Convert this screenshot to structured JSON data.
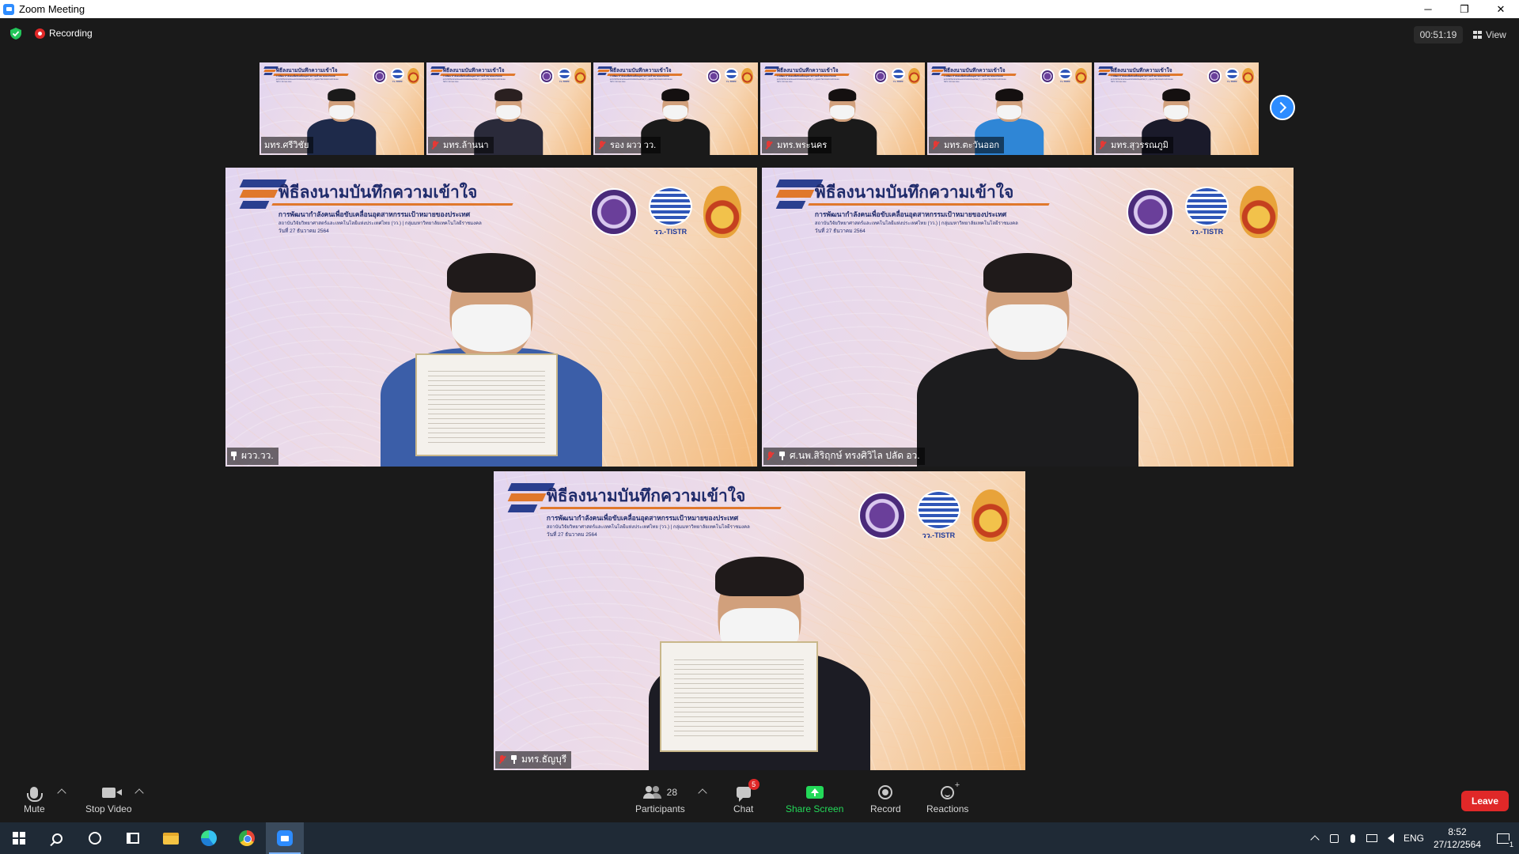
{
  "window": {
    "title": "Zoom Meeting",
    "controls": [
      "─",
      "❐",
      "✕"
    ]
  },
  "status": {
    "recording_label": "Recording",
    "elapsed": "00:51:19",
    "view_label": "View"
  },
  "slide": {
    "heading": "พิธีลงนามบันทึกความเข้าใจ",
    "subtitle": "การพัฒนากำลังคนเพื่อขับเคลื่อนอุตสาหกรรมเป้าหมายของประเทศ",
    "org_line": "สถาบันวิจัยวิทยาศาสตร์และเทคโนโลยีแห่งประเทศไทย (วว.) | กลุ่มมหาวิทยาลัยเทคโนโลยีราชมงคล",
    "date_line": "วันที่ 27 ธันวาคม 2564",
    "tistra_label": "วว.-TISTR"
  },
  "thumbnails": [
    {
      "name": "มทร.ศรีวิชัย",
      "muted": false,
      "suit": "#1e2a4a",
      "hair": "#1a1a1a"
    },
    {
      "name": "มทร.ล้านนา",
      "muted": true,
      "suit": "#2a2a3a",
      "hair": "#2a2020"
    },
    {
      "name": "รอง ผวว วว.",
      "muted": true,
      "suit": "#1a1a1a",
      "hair": "#141010"
    },
    {
      "name": "มทร.พระนคร",
      "muted": true,
      "suit": "#1a1a1a",
      "hair": "#141010"
    },
    {
      "name": "มทร.ตะวันออก",
      "muted": true,
      "suit": "#2f86d6",
      "hair": "#141010"
    },
    {
      "name": "มทร.สุวรรณภูมิ",
      "muted": true,
      "suit": "#1a1a2a",
      "hair": "#141010"
    }
  ],
  "speakers": [
    {
      "name": "ผวว.วว.",
      "muted": false,
      "pinned": true,
      "suit": "#3b5ea8",
      "placard": "ดร.ชุติมา เอี่ยมโชติชวลิต"
    },
    {
      "name": "ศ.นพ.สิริฤกษ์ ทรงศิวิไล ปลัด อว.",
      "muted": true,
      "pinned": true,
      "suit": "#1c1c1e"
    },
    {
      "name": "มทร.ธัญบุรี",
      "muted": true,
      "pinned": true,
      "suit": "#1c1c24",
      "placard": "รองศาสตราจารย์ ดร.สมหมาย ผิวสอาด"
    }
  ],
  "toolbar": {
    "mute_label": "Mute",
    "video_label": "Stop Video",
    "participants_label": "Participants",
    "participants_count": "28",
    "chat_label": "Chat",
    "chat_badge": "5",
    "share_label": "Share Screen",
    "record_label": "Record",
    "reactions_label": "Reactions",
    "leave_label": "Leave",
    "share_color": "#23d959",
    "leave_color": "#e02828"
  },
  "taskbar": {
    "apps": [
      "windows-start",
      "search",
      "cortana",
      "task-view",
      "file-explorer",
      "edge",
      "chrome",
      "zoom"
    ],
    "language": "ENG",
    "time": "8:52",
    "date": "27/12/2564",
    "notifications": "1"
  }
}
